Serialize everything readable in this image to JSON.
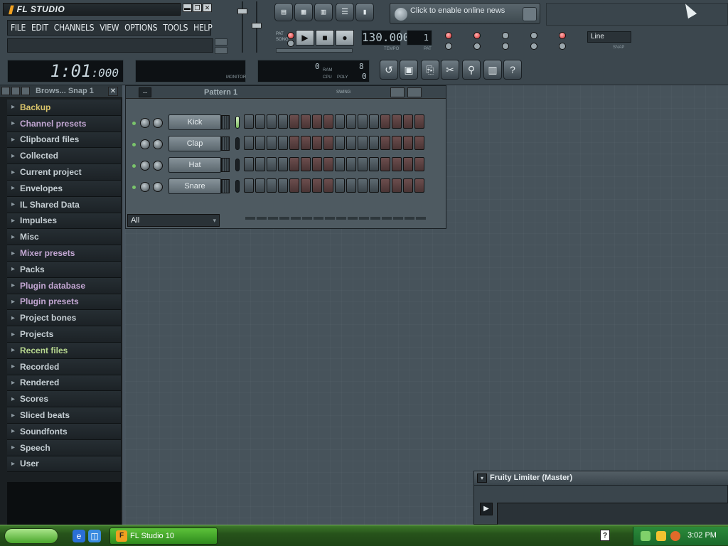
{
  "app": {
    "title": "FL STUDIO",
    "menu": [
      "FILE",
      "EDIT",
      "CHANNELS",
      "VIEW",
      "OPTIONS",
      "TOOLS",
      "HELP"
    ]
  },
  "news": {
    "text": "Click to enable online news"
  },
  "transport": {
    "pat_label": "PAT",
    "song_label": "SONG",
    "tempo": "130.000",
    "tempo_label": "TEMPO",
    "pattern_num": "1",
    "pattern_num_label": "PAT",
    "snap_value": "Line",
    "snap_label": "SNAP"
  },
  "time": {
    "main": "1:01",
    "ms": ":000"
  },
  "scope": {
    "label": "MONITOR"
  },
  "cpu": {
    "poly": "0",
    "cpu_label": "CPU",
    "poly_label": "POLY",
    "ram_label": "RAM",
    "val1": "0",
    "val2": "8"
  },
  "browser": {
    "title": "Brows... Snap 1",
    "items": [
      {
        "label": "Backup",
        "icon": "folder-icon",
        "style": "hl"
      },
      {
        "label": "Channel presets",
        "icon": "folder-icon",
        "style": "pur"
      },
      {
        "label": "Clipboard files",
        "icon": "folder-icon",
        "style": ""
      },
      {
        "label": "Collected",
        "icon": "folder-icon",
        "style": ""
      },
      {
        "label": "Current project",
        "icon": "folder-icon",
        "style": ""
      },
      {
        "label": "Envelopes",
        "icon": "folder-icon",
        "style": ""
      },
      {
        "label": "IL Shared Data",
        "icon": "folder-icon",
        "style": ""
      },
      {
        "label": "Impulses",
        "icon": "folder-icon",
        "style": ""
      },
      {
        "label": "Misc",
        "icon": "folder-icon",
        "style": ""
      },
      {
        "label": "Mixer presets",
        "icon": "folder-icon",
        "style": "pur"
      },
      {
        "label": "Packs",
        "icon": "folder-icon",
        "style": ""
      },
      {
        "label": "Plugin database",
        "icon": "folder-icon",
        "style": "pur"
      },
      {
        "label": "Plugin presets",
        "icon": "folder-icon",
        "style": "pur"
      },
      {
        "label": "Project bones",
        "icon": "folder-icon",
        "style": ""
      },
      {
        "label": "Projects",
        "icon": "folder-icon",
        "style": ""
      },
      {
        "label": "Recent files",
        "icon": "folder-icon",
        "style": "grn"
      },
      {
        "label": "Recorded",
        "icon": "folder-icon",
        "style": ""
      },
      {
        "label": "Rendered",
        "icon": "folder-icon",
        "style": ""
      },
      {
        "label": "Scores",
        "icon": "folder-icon",
        "style": ""
      },
      {
        "label": "Sliced beats",
        "icon": "folder-icon",
        "style": ""
      },
      {
        "label": "Soundfonts",
        "icon": "folder-icon",
        "style": ""
      },
      {
        "label": "Speech",
        "icon": "folder-icon",
        "style": ""
      },
      {
        "label": "User",
        "icon": "folder-icon",
        "style": ""
      }
    ]
  },
  "stepseq": {
    "pattern": "Pattern 1",
    "swing_label": "SWING",
    "tag": "--",
    "channels": [
      {
        "name": "Kick"
      },
      {
        "name": "Clap"
      },
      {
        "name": "Hat"
      },
      {
        "name": "Snare"
      }
    ],
    "filter": "All"
  },
  "limiter": {
    "title": "Fruity Limiter (Master)"
  },
  "taskbar": {
    "task": "FL Studio 10",
    "clock": "3:02 PM",
    "help": "?"
  }
}
